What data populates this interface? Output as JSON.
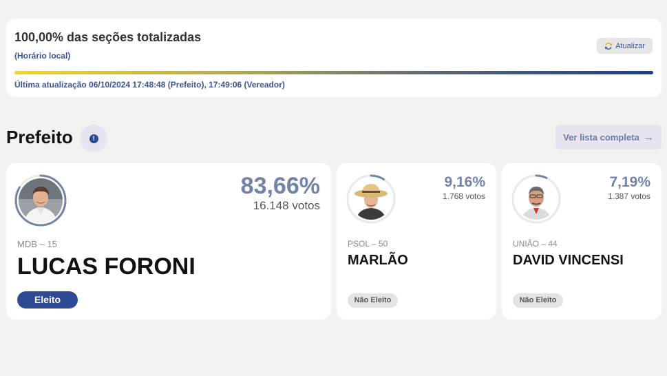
{
  "status": {
    "title": "100,00% das seções totalizadas",
    "subtitle": "(Horário local)",
    "refresh_label": "Atualizar",
    "progress_fraction": 1.0,
    "last_update": "Última atualização 06/10/2024 17:48:48 (Prefeito), 17:49:06 (Vereador)"
  },
  "section": {
    "title": "Prefeito",
    "info_glyph": "!",
    "list_button_label": "Ver lista completa",
    "list_button_arrow": "→"
  },
  "candidates": [
    {
      "name": "LUCAS FORONI",
      "party": "MDB – 15",
      "percent": "83,66%",
      "votes": "16.148 votos",
      "vote_fraction": 0.8366,
      "status": "Eleito",
      "accent": "#7283a8"
    },
    {
      "name": "MARLÃO",
      "party": "PSOL – 50",
      "percent": "9,16%",
      "votes": "1.768 votos",
      "vote_fraction": 0.0916,
      "status": "Não Eleito",
      "accent": "#7283a8"
    },
    {
      "name": "DAVID VINCENSI",
      "party": "UNIÃO – 44",
      "percent": "7,19%",
      "votes": "1.387 votos",
      "vote_fraction": 0.0719,
      "status": "Não Eleito",
      "accent": "#7283a8"
    }
  ],
  "colors": {
    "brand_blue": "#2e4a94",
    "percent_text": "#7283a8",
    "progress_start": "#f1d91a",
    "progress_end": "#1a3d8f"
  },
  "icons": {
    "refresh": "refresh-icon",
    "info": "info-icon",
    "arrow": "arrow-right-icon"
  }
}
